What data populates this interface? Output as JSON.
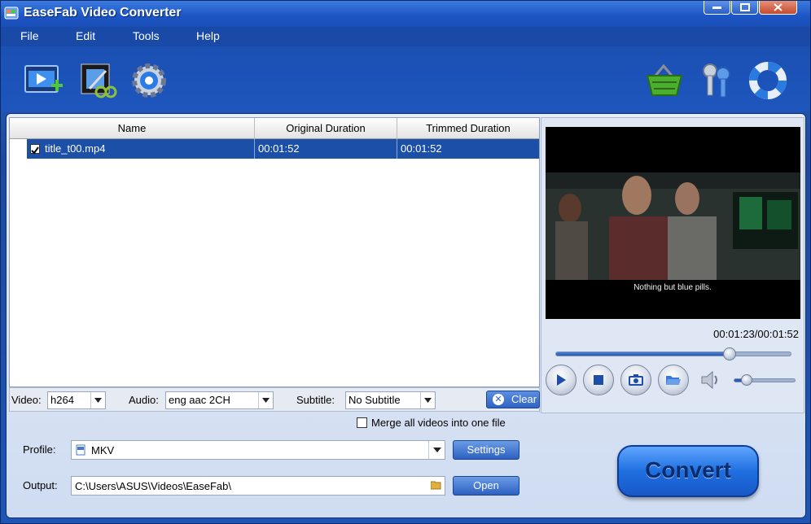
{
  "window": {
    "title": "EaseFab Video Converter"
  },
  "menu": {
    "items": [
      "File",
      "Edit",
      "Tools",
      "Help"
    ]
  },
  "toolbar": {
    "left_icons": [
      "add-video-icon",
      "edit-video-icon",
      "settings-gear-icon"
    ],
    "right_icons": [
      "shop-basket-icon",
      "register-keys-icon",
      "help-lifebuoy-icon"
    ]
  },
  "file_list": {
    "columns": [
      "Name",
      "Original Duration",
      "Trimmed Duration"
    ],
    "rows": [
      {
        "checked": true,
        "name": "title_t00.mp4",
        "original_duration": "00:01:52",
        "trimmed_duration": "00:01:52"
      }
    ]
  },
  "streams": {
    "video_label": "Video:",
    "video_value": "h264",
    "audio_label": "Audio:",
    "audio_value": "eng aac 2CH",
    "subtitle_label": "Subtitle:",
    "subtitle_value": "No Subtitle",
    "clear_label": "Clear"
  },
  "preview": {
    "subtitle_text": "Nothing but blue pills.",
    "time": "00:01:23/00:01:52",
    "progress": 0.74,
    "volume": 0.2
  },
  "merge": {
    "label": "Merge all videos into one file",
    "checked": false
  },
  "profile": {
    "label": "Profile:",
    "value": "MKV",
    "settings_label": "Settings"
  },
  "output": {
    "label": "Output:",
    "value": "C:\\Users\\ASUS\\Videos\\EaseFab\\",
    "open_label": "Open"
  },
  "convert": {
    "label": "Convert"
  },
  "colors": {
    "accent": "#1c4fa8",
    "window": "#1e55b5",
    "panel": "#dfe7f4"
  }
}
